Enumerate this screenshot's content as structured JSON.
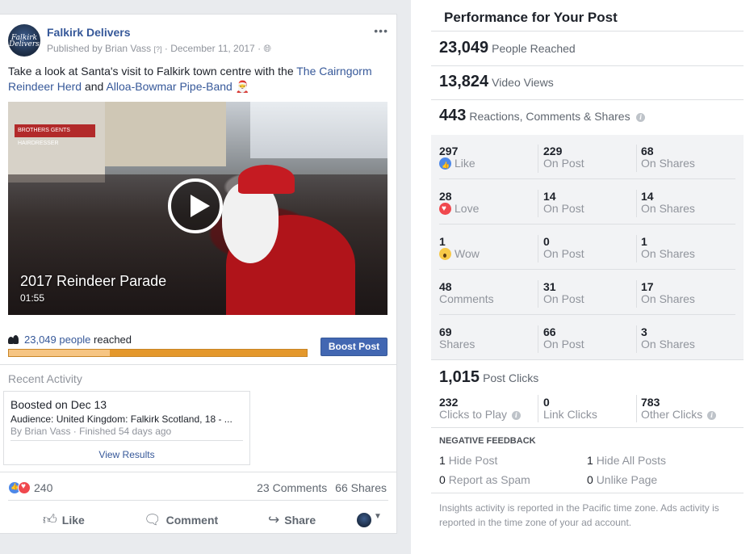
{
  "post": {
    "page_name": "Falkirk Delivers",
    "avatar_text": "Falkirk Delivers",
    "published_by": "Published by Brian Vass",
    "help_marker": "[?]",
    "date": "December 11, 2017",
    "text_prefix": "Take a look at Santa's visit to Falkirk town centre with the ",
    "link1": "The Cairngorm Reindeer Herd",
    "text_mid": " and ",
    "link2": "Alloa-Bowmar Pipe-Band",
    "video_title": "2017 Reindeer Parade",
    "video_duration": "01:55",
    "video_sign": "BROTHERS GENTS HAIRDRESSER",
    "reach_count": "23,049 people",
    "reach_suffix": " reached",
    "reach_fraction": 0.34,
    "boost_label": "Boost Post",
    "recent_title": "Recent Activity",
    "activity": {
      "title": "Boosted on Dec 13",
      "audience": "Audience: United Kingdom: Falkirk Scotland, 18 - ...",
      "by": "By Brian Vass · Finished 54 days ago",
      "link": "View Results"
    },
    "reactions_count": "240",
    "comments": "23 Comments",
    "shares": "66 Shares",
    "actions": {
      "like": "Like",
      "comment": "Comment",
      "share": "Share"
    }
  },
  "panel": {
    "title": "Performance for Your Post",
    "reached": {
      "value": "23,049",
      "label": "People Reached"
    },
    "views": {
      "value": "13,824",
      "label": "Video Views"
    },
    "engagement": {
      "value": "443",
      "label": "Reactions, Comments & Shares"
    },
    "rows": [
      {
        "total": "297",
        "label": "Like",
        "on_post": "229",
        "on_post_label": "On Post",
        "on_shares": "68",
        "on_shares_label": "On Shares"
      },
      {
        "total": "28",
        "label": "Love",
        "on_post": "14",
        "on_post_label": "On Post",
        "on_shares": "14",
        "on_shares_label": "On Shares"
      },
      {
        "total": "1",
        "label": "Wow",
        "on_post": "0",
        "on_post_label": "On Post",
        "on_shares": "1",
        "on_shares_label": "On Shares"
      },
      {
        "total": "48",
        "label": "Comments",
        "on_post": "31",
        "on_post_label": "On Post",
        "on_shares": "17",
        "on_shares_label": "On Shares"
      },
      {
        "total": "69",
        "label": "Shares",
        "on_post": "66",
        "on_post_label": "On Post",
        "on_shares": "3",
        "on_shares_label": "On Shares"
      }
    ],
    "clicks": {
      "value": "1,015",
      "label": "Post Clicks"
    },
    "click_breakdown": [
      {
        "value": "232",
        "label": "Clicks to Play"
      },
      {
        "value": "0",
        "label": "Link Clicks"
      },
      {
        "value": "783",
        "label": "Other Clicks"
      }
    ],
    "negative_title": "NEGATIVE FEEDBACK",
    "negative": [
      {
        "value": "1",
        "label": "Hide Post"
      },
      {
        "value": "1",
        "label": "Hide All Posts"
      },
      {
        "value": "0",
        "label": "Report as Spam"
      },
      {
        "value": "0",
        "label": "Unlike Page"
      }
    ],
    "footnote": "Insights activity is reported in the Pacific time zone. Ads activity is reported in the time zone of your ad account."
  },
  "colors": {
    "link": "#365899",
    "boost": "#4267b2",
    "reach_bar": "#e4982c",
    "reach_fill": "#f6c583"
  },
  "icons": [
    "more-icon",
    "globe-icon",
    "santa-emoji-icon",
    "play-icon",
    "people-icon",
    "like-icon",
    "love-icon",
    "wow-icon",
    "comment-icon",
    "share-icon",
    "info-icon",
    "caret-down-icon"
  ]
}
